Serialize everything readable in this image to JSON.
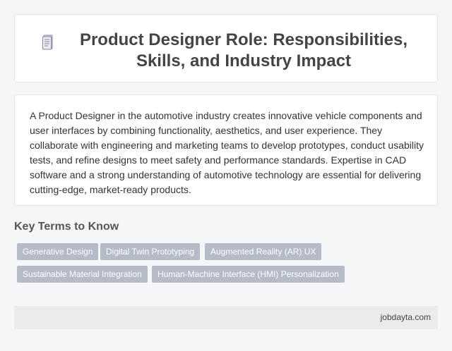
{
  "header": {
    "icon": "document-icon",
    "title": "Product Designer Role: Responsibilities, Skills, and Industry Impact"
  },
  "description": "A Product Designer in the automotive industry creates innovative vehicle components and user interfaces by combining functionality, aesthetics, and user experience. They collaborate with engineering and marketing teams to develop prototypes, conduct usability tests, and refine designs to meet safety and performance standards. Expertise in CAD software and a strong understanding of automotive technology are essential for delivering cutting-edge, market-ready products.",
  "key_terms": {
    "heading": "Key Terms to Know",
    "tags": [
      "Generative Design",
      "Digital Twin Prototyping",
      "Augmented Reality (AR) UX",
      "Sustainable Material Integration",
      "Human-Machine Interface (HMI) Personalization"
    ]
  },
  "footer": {
    "site": "jobdayta.com"
  },
  "colors": {
    "tag_bg": "#b5bcc8",
    "footer_bg": "#e9ecea",
    "page_bg": "#f5f6f7"
  }
}
